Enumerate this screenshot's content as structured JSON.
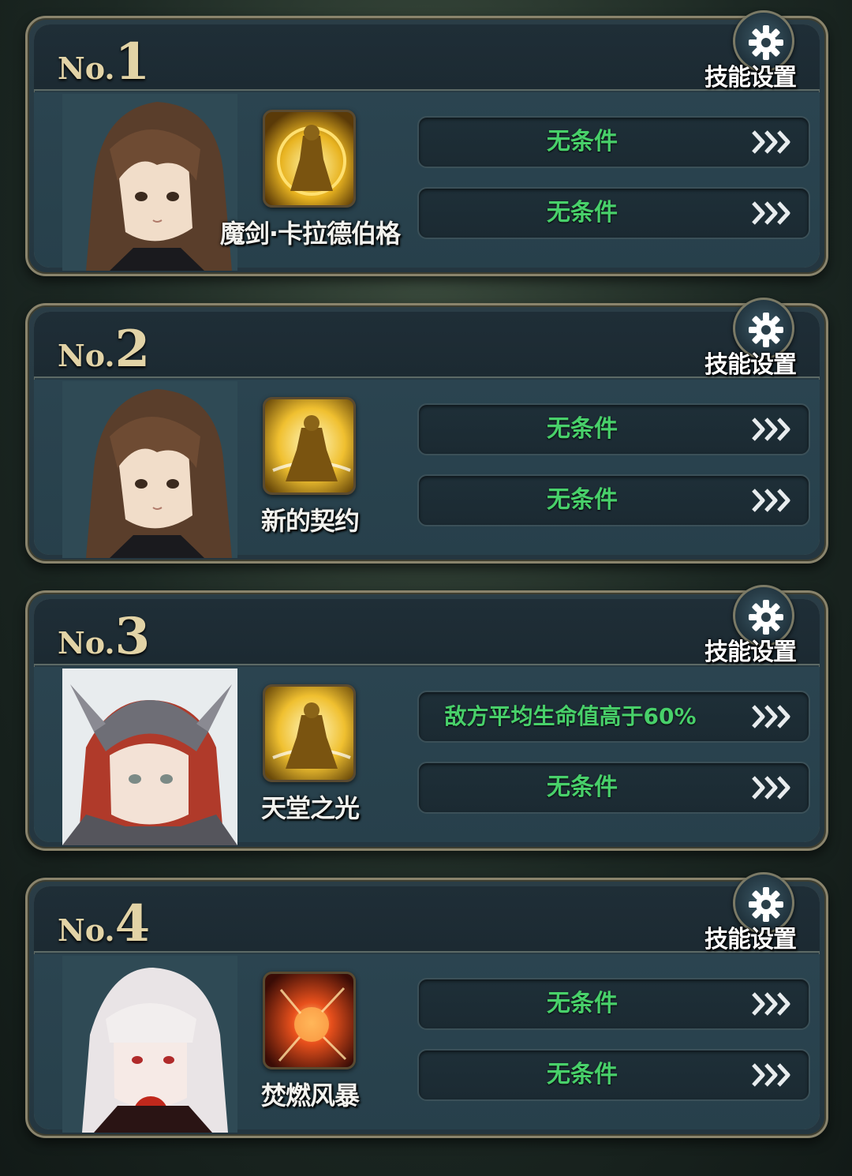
{
  "cards": [
    {
      "no_prefix": "No.",
      "no_number": "1",
      "settings_label": "技能设置",
      "settings_icon": "gear-icon",
      "character": "brown-hair-girl",
      "skill_icon": "golden-knight-skill-icon",
      "skill_name": "魔剑·卡拉德伯格",
      "conditions": [
        "无条件",
        "无条件"
      ]
    },
    {
      "no_prefix": "No.",
      "no_number": "2",
      "settings_label": "技能设置",
      "settings_icon": "gear-icon",
      "character": "brown-hair-girl",
      "skill_icon": "golden-knight-skill-icon",
      "skill_name": "新的契约",
      "conditions": [
        "无条件",
        "无条件"
      ]
    },
    {
      "no_prefix": "No.",
      "no_number": "3",
      "settings_label": "技能设置",
      "settings_icon": "gear-icon",
      "character": "red-hair-armored-knight",
      "skill_icon": "golden-knight-skill-icon",
      "skill_name": "天堂之光",
      "conditions": [
        "敌方平均生命值高于60%",
        "无条件"
      ]
    },
    {
      "no_prefix": "No.",
      "no_number": "4",
      "settings_label": "技能设置",
      "settings_icon": "gear-icon",
      "character": "white-hair-girl",
      "skill_icon": "fire-explosion-skill-icon",
      "skill_name": "焚燃风暴",
      "conditions": [
        "无条件",
        "无条件"
      ]
    }
  ],
  "colors": {
    "condition_text": "#48d06a",
    "number_gold": "#e2d3a6",
    "frame": "#8a846c"
  }
}
